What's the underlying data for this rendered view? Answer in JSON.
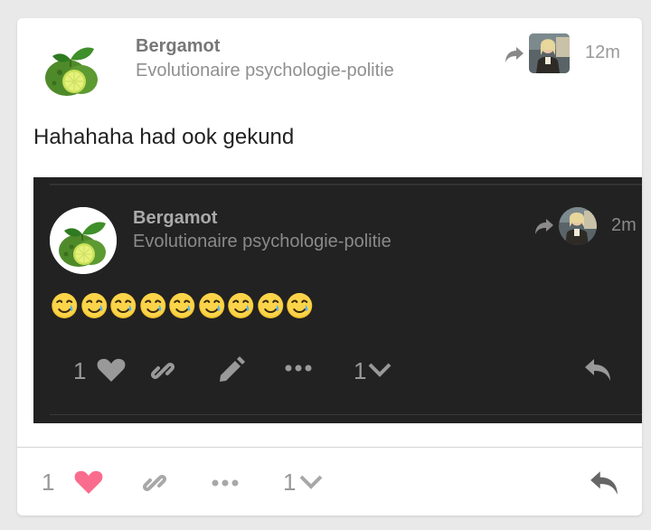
{
  "post": {
    "username": "Bergamot",
    "title": "Evolutionaire psychologie-politie",
    "time": "12m",
    "body": "Hahahaha had ook gekund",
    "like_count": "1",
    "replies_count": "1"
  },
  "quote": {
    "username": "Bergamot",
    "title": "Evolutionaire psychologie-politie",
    "time": "2m",
    "emoji_count": 9,
    "like_count": "1",
    "replies_count": "1"
  },
  "colors": {
    "like_active": "#fa6c8d",
    "icon_gray": "#999999",
    "quote_bg": "#222222"
  }
}
